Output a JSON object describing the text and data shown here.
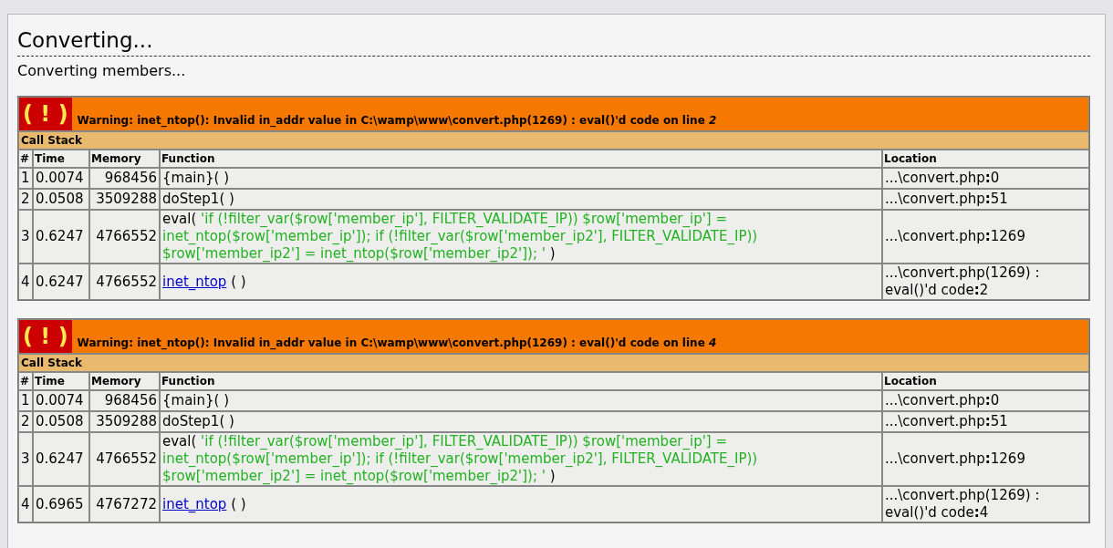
{
  "page": {
    "title": "Converting...",
    "status": "Converting members..."
  },
  "warnings": [
    {
      "icon": "( ! )",
      "message": "Warning: inet_ntop(): Invalid in_addr value in C:\\wamp\\www\\convert.php(1269) : eval()'d code on line *2*",
      "stack_title": "Call Stack",
      "columns": [
        "#",
        "Time",
        "Memory",
        "Function",
        "Location"
      ],
      "rows": [
        {
          "index": "1",
          "time": "0.0074",
          "memory": "968456",
          "function": {
            "kind": "plain",
            "text": "{main}( )"
          },
          "location": "...\\convert.php**:**0"
        },
        {
          "index": "2",
          "time": "0.0508",
          "memory": "3509288",
          "function": {
            "kind": "plain",
            "text": "doStep1( )"
          },
          "location": "...\\convert.php**:**51"
        },
        {
          "index": "3",
          "time": "0.6247",
          "memory": "4766552",
          "function": {
            "kind": "eval",
            "text": "eval(",
            "args": "'if (!filter_var($row['member_ip'], FILTER_VALIDATE_IP)) $row['member_ip'] = inet_ntop($row['member_ip']); if (!filter_var($row['member_ip2'], FILTER_VALIDATE_IP)) $row['member_ip2'] = inet_ntop($row['member_ip2']); '",
            "close": ")"
          },
          "location": "...\\convert.php**:**1269"
        },
        {
          "index": "4",
          "time": "0.6247",
          "memory": "4766552",
          "function": {
            "kind": "link",
            "text": "inet_ntop",
            "close": "( )"
          },
          "location": "...\\convert.php(1269) : eval()'d code**:**2"
        }
      ]
    },
    {
      "icon": "( ! )",
      "message": "Warning: inet_ntop(): Invalid in_addr value in C:\\wamp\\www\\convert.php(1269) : eval()'d code on line *4*",
      "stack_title": "Call Stack",
      "columns": [
        "#",
        "Time",
        "Memory",
        "Function",
        "Location"
      ],
      "rows": [
        {
          "index": "1",
          "time": "0.0074",
          "memory": "968456",
          "function": {
            "kind": "plain",
            "text": "{main}( )"
          },
          "location": "...\\convert.php**:**0"
        },
        {
          "index": "2",
          "time": "0.0508",
          "memory": "3509288",
          "function": {
            "kind": "plain",
            "text": "doStep1( )"
          },
          "location": "...\\convert.php**:**51"
        },
        {
          "index": "3",
          "time": "0.6247",
          "memory": "4766552",
          "function": {
            "kind": "eval",
            "text": "eval(",
            "args": "'if (!filter_var($row['member_ip'], FILTER_VALIDATE_IP)) $row['member_ip'] = inet_ntop($row['member_ip']); if (!filter_var($row['member_ip2'], FILTER_VALIDATE_IP)) $row['member_ip2'] = inet_ntop($row['member_ip2']); '",
            "close": ")"
          },
          "location": "...\\convert.php**:**1269"
        },
        {
          "index": "4",
          "time": "0.6965",
          "memory": "4767272",
          "function": {
            "kind": "link",
            "text": "inet_ntop",
            "close": "( )"
          },
          "location": "...\\convert.php(1269) : eval()'d code**:**4"
        }
      ]
    }
  ]
}
